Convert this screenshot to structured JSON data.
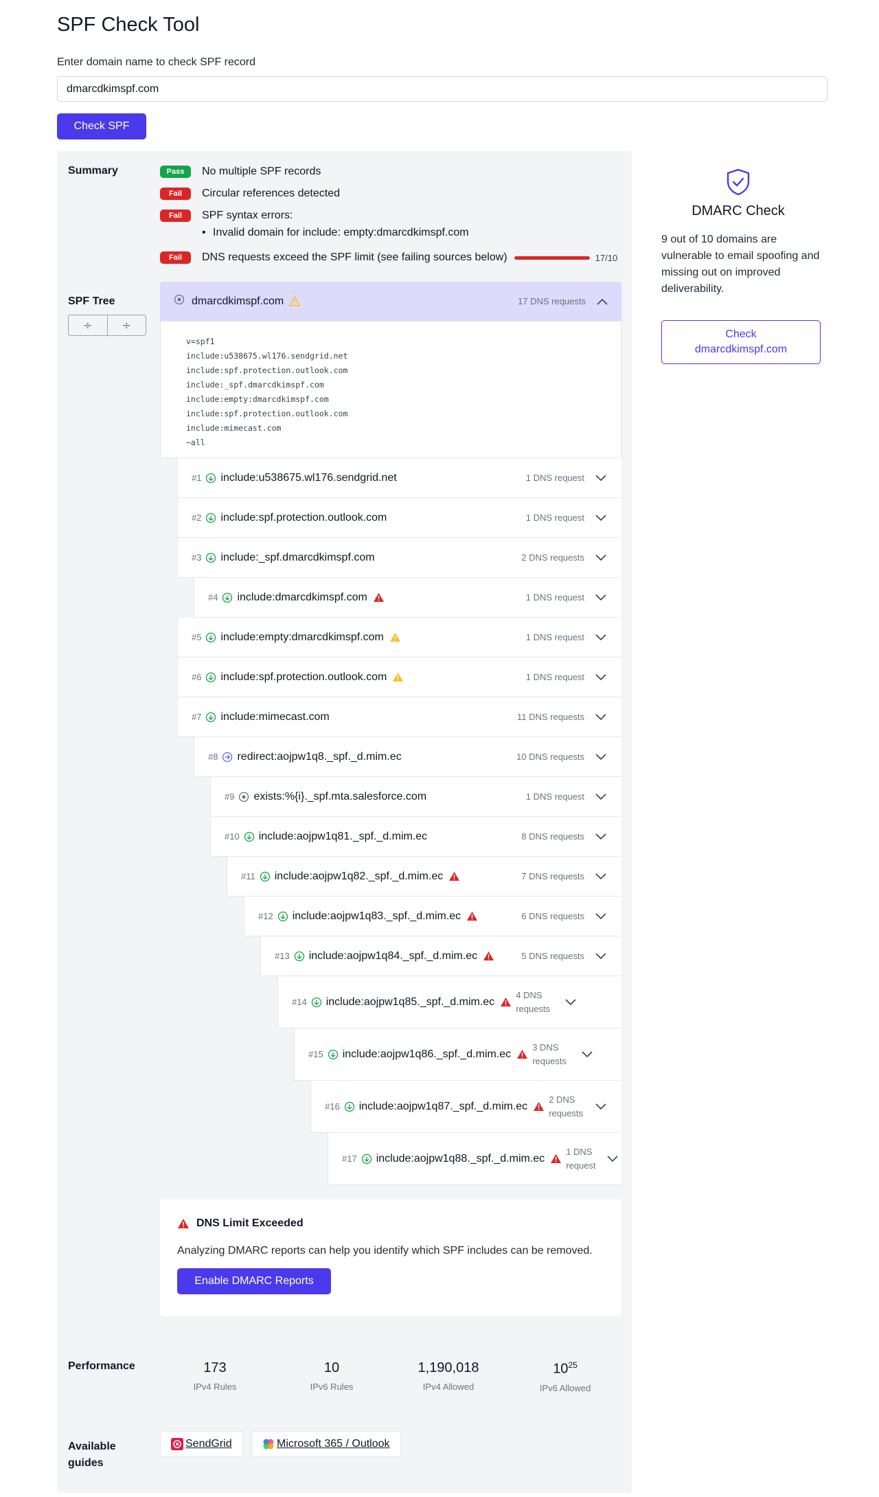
{
  "page": {
    "title": "SPF Check Tool",
    "input_label": "Enter domain name to check SPF record",
    "domain_value": "dmarcdkimspf.com",
    "check_button": "Check SPF"
  },
  "summary": {
    "label": "Summary",
    "items": [
      {
        "status": "Pass",
        "text": "No multiple SPF records"
      },
      {
        "status": "Fail",
        "text": "Circular references detected"
      },
      {
        "status": "Fail",
        "text": "SPF syntax errors:"
      },
      {
        "status": "Fail",
        "text": "DNS requests exceed the SPF limit (see failing sources below)"
      }
    ],
    "syntax_error_detail": "Invalid domain for include: empty:dmarcdkimspf.com",
    "dns_limit": {
      "used": 17,
      "limit": 10,
      "label": "17/10"
    },
    "colors": {
      "pass": "#16a34a",
      "fail": "#dc2626"
    }
  },
  "spf_tree": {
    "label": "SPF Tree",
    "tools": {
      "collapse_icon": "divide-icon",
      "expand_icon": "divide-icon"
    },
    "root": {
      "name": "dmarcdkimspf.com",
      "count": "17 DNS requests",
      "record": [
        "v=spf1",
        "include:u538675.wl176.sendgrid.net",
        "include:spf.protection.outlook.com",
        "include:_spf.dmarcdkimspf.com",
        "include:empty:dmarcdkimspf.com",
        "include:spf.protection.outlook.com",
        "include:mimecast.com",
        "~all"
      ]
    },
    "nodes": [
      {
        "num": "#1",
        "name": "include:u538675.wl176.sendgrid.net",
        "count": "1 DNS request",
        "icon": "include-arrow-icon",
        "warn": "none"
      },
      {
        "num": "#2",
        "name": "include:spf.protection.outlook.com",
        "count": "1 DNS request",
        "icon": "include-arrow-icon",
        "warn": "none"
      },
      {
        "num": "#3",
        "name": "include:_spf.dmarcdkimspf.com",
        "count": "2 DNS requests",
        "icon": "include-arrow-icon",
        "warn": "none"
      },
      {
        "num": "#4",
        "name": "include:dmarcdkimspf.com",
        "count": "1 DNS request",
        "icon": "include-arrow-icon",
        "warn": "error"
      },
      {
        "num": "#5",
        "name": "include:empty:dmarcdkimspf.com",
        "count": "1 DNS request",
        "icon": "include-arrow-icon",
        "warn": "warning"
      },
      {
        "num": "#6",
        "name": "include:spf.protection.outlook.com",
        "count": "1 DNS request",
        "icon": "include-arrow-icon",
        "warn": "warning"
      },
      {
        "num": "#7",
        "name": "include:mimecast.com",
        "count": "11 DNS requests",
        "icon": "include-arrow-icon",
        "warn": "none"
      },
      {
        "num": "#8",
        "name": "redirect:aojpw1q8._spf._d.mim.ec",
        "count": "10 DNS requests",
        "icon": "redirect-arrow-icon",
        "warn": "none"
      },
      {
        "num": "#9",
        "name": "exists:%{i}._spf.mta.salesforce.com",
        "count": "1 DNS request",
        "icon": "exists-dot-icon",
        "warn": "none"
      },
      {
        "num": "#10",
        "name": "include:aojpw1q81._spf._d.mim.ec",
        "count": "8 DNS requests",
        "icon": "include-arrow-icon",
        "warn": "none"
      },
      {
        "num": "#11",
        "name": "include:aojpw1q82._spf._d.mim.ec",
        "count": "7 DNS requests",
        "icon": "include-arrow-icon",
        "warn": "error"
      },
      {
        "num": "#12",
        "name": "include:aojpw1q83._spf._d.mim.ec",
        "count": "6 DNS requests",
        "icon": "include-arrow-icon",
        "warn": "error"
      },
      {
        "num": "#13",
        "name": "include:aojpw1q84._spf._d.mim.ec",
        "count": "5 DNS requests",
        "icon": "include-arrow-icon",
        "warn": "error"
      },
      {
        "num": "#14",
        "name": "include:aojpw1q85._spf._d.mim.ec",
        "count": "4 DNS requests",
        "icon": "include-arrow-icon",
        "warn": "error"
      },
      {
        "num": "#15",
        "name": "include:aojpw1q86._spf._d.mim.ec",
        "count": "3 DNS requests",
        "icon": "include-arrow-icon",
        "warn": "error"
      },
      {
        "num": "#16",
        "name": "include:aojpw1q87._spf._d.mim.ec",
        "count": "2 DNS requests",
        "icon": "include-arrow-icon",
        "warn": "error"
      },
      {
        "num": "#17",
        "name": "include:aojpw1q88._spf._d.mim.ec",
        "count": "1 DNS request",
        "icon": "include-arrow-icon",
        "warn": "error"
      }
    ]
  },
  "alert": {
    "title": "DNS Limit Exceeded",
    "text": "Analyzing DMARC reports can help you identify which SPF includes can be removed.",
    "button": "Enable DMARC Reports"
  },
  "performance": {
    "label": "Performance",
    "stats": [
      {
        "value": "173",
        "label": "IPv4 Rules"
      },
      {
        "value": "10",
        "label": "IPv6 Rules"
      },
      {
        "value": "1,190,018",
        "label": "IPv4 Allowed"
      },
      {
        "value": "10",
        "exponent": "25",
        "label": "IPv6 Allowed"
      }
    ]
  },
  "guides": {
    "label_line1": "Available",
    "label_line2": "guides",
    "items": [
      {
        "label": "SendGrid",
        "icon": "sendgrid-logo-icon"
      },
      {
        "label": "Microsoft 365 / Outlook",
        "icon": "microsoft-copilot-logo-icon"
      }
    ]
  },
  "dmarc": {
    "icon": "shield-check-icon",
    "title": "DMARC Check",
    "text": "9 out of 10 domains are vulnerable to email spoofing and missing out on improved deliverability.",
    "button_line1": "Check",
    "button_line2": "dmarcdkimspf.com"
  },
  "colors": {
    "accent": "#4a3aeb",
    "root_bg": "#dcdbfb",
    "panel_bg": "#f3f4f6",
    "include_icon": "#16a34a",
    "redirect_icon": "#6366f1",
    "warning": "#fbbf24",
    "error": "#dc2626"
  }
}
